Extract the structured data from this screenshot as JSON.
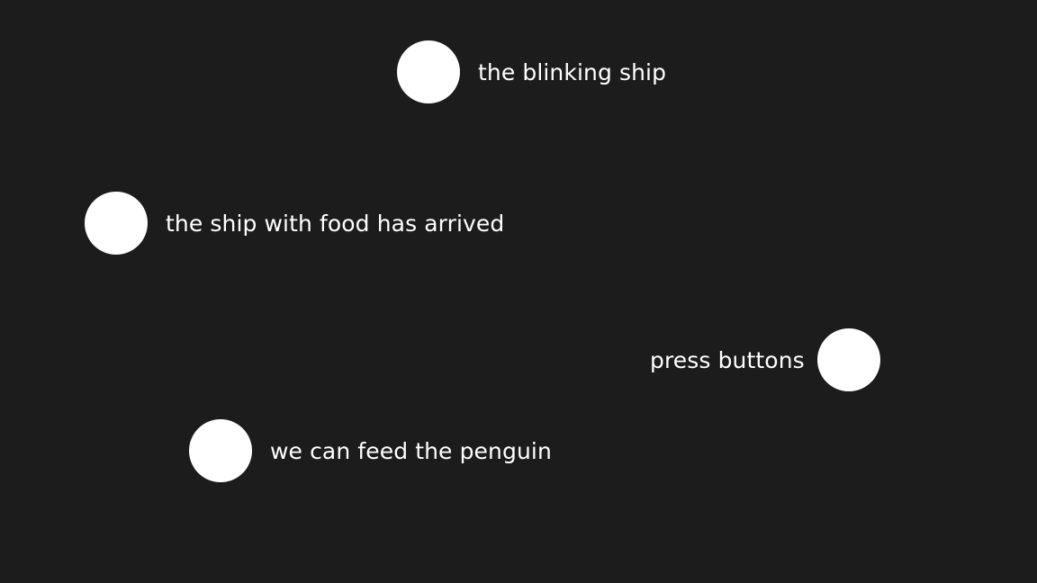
{
  "background_color": "#1c1c1c",
  "choice_color": "#ffffff",
  "choices": [
    {
      "text": "the blinking ship",
      "icon": "circle-node"
    },
    {
      "text": "the ship with food has arrived",
      "icon": "circle-node"
    },
    {
      "text": "press buttons",
      "icon": "circle-node"
    },
    {
      "text": "we can feed the penguin",
      "icon": "circle-node"
    }
  ]
}
